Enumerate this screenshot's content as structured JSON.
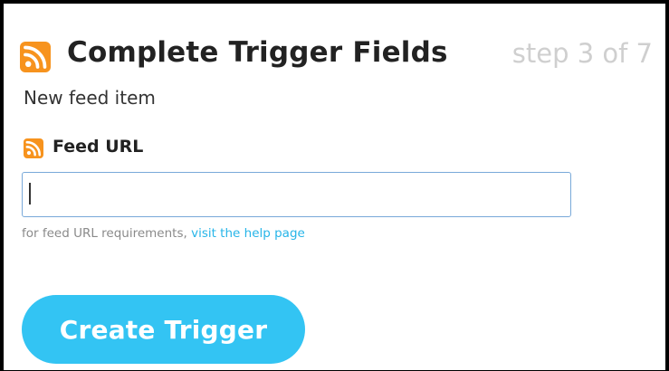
{
  "header": {
    "title": "Complete Trigger Fields",
    "step": "step 3 of 7",
    "icon": "rss-icon"
  },
  "subtitle": "New feed item",
  "field": {
    "label": "Feed URL",
    "icon": "rss-icon",
    "value": "",
    "placeholder": ""
  },
  "helper": {
    "text": "for feed URL requirements, ",
    "link": "visit the help page"
  },
  "button": {
    "label": "Create Trigger"
  },
  "colors": {
    "rss": "#f7931e",
    "accent": "#33c4f3",
    "link": "#27b5e8",
    "input_border": "#79a9d9",
    "step_text": "#cfcfcf"
  }
}
